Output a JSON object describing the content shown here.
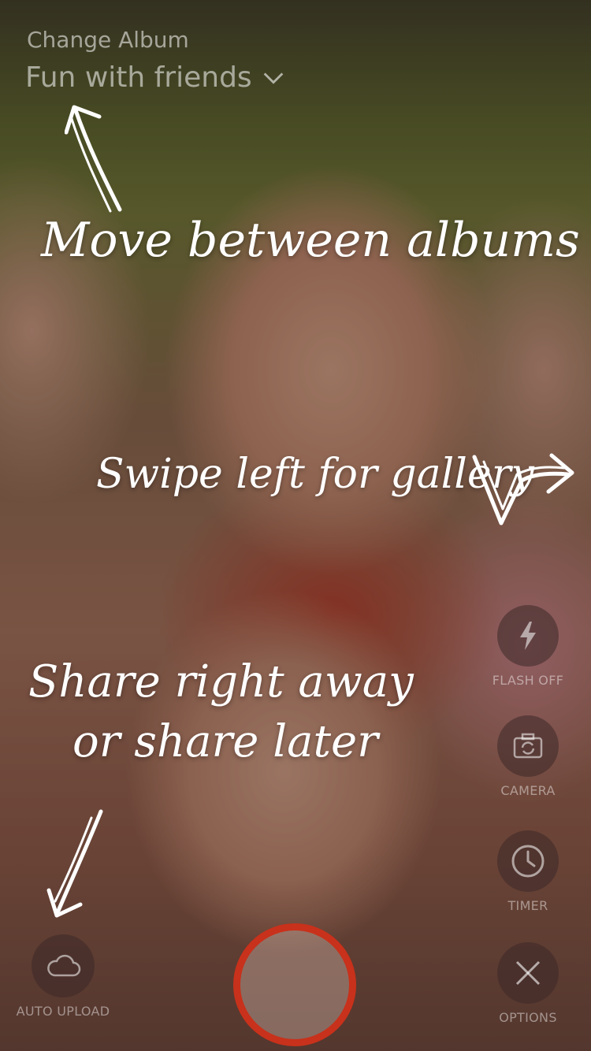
{
  "header": {
    "change_label": "Change Album",
    "album_name": "Fun with friends"
  },
  "hints": {
    "move_albums": "Move between albums",
    "swipe_gallery": "Swipe left for gallery",
    "share_line1": "Share right away",
    "share_line2": "or share later"
  },
  "controls": {
    "flash": {
      "label": "FLASH OFF",
      "icon": "lightning-bolt-icon"
    },
    "camera": {
      "label": "CAMERA",
      "icon": "camera-switch-icon"
    },
    "timer": {
      "label": "TIMER",
      "icon": "clock-icon"
    },
    "options": {
      "label": "OPTIONS",
      "icon": "close-x-icon"
    },
    "auto_upload": {
      "label": "AUTO UPLOAD",
      "icon": "cloud-icon"
    }
  },
  "colors": {
    "shutter_ring": "#c8311b",
    "hint_text": "#ffffff"
  }
}
